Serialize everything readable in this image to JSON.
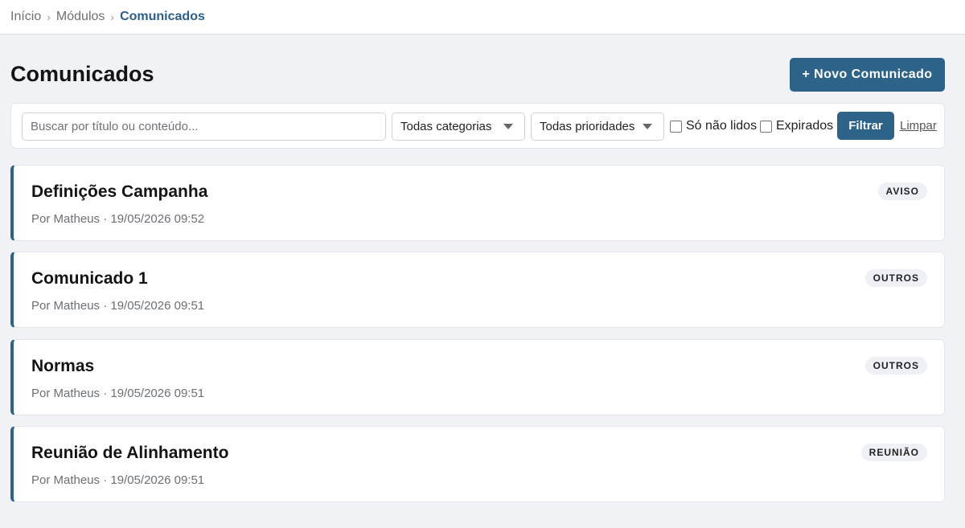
{
  "breadcrumb": {
    "items": [
      "Início",
      "Módulos",
      "Comunicados"
    ],
    "separator": "›"
  },
  "page": {
    "title": "Comunicados",
    "new_button_label": "+ Novo Comunicado"
  },
  "filters": {
    "search_placeholder": "Buscar por título ou conteúdo...",
    "search_value": "",
    "category_selected": "Todas categorias",
    "priority_selected": "Todas prioridades",
    "only_unread_label": "Só não lidos",
    "only_unread_checked": false,
    "expired_label": "Expirados",
    "expired_checked": false,
    "filter_button_label": "Filtrar",
    "clear_link_label": "Limpar"
  },
  "announcements": [
    {
      "title": "Definições Campanha",
      "meta": "Por Matheus · 19/05/2026 09:52",
      "badge": "AVISO"
    },
    {
      "title": "Comunicado 1",
      "meta": "Por Matheus · 19/05/2026 09:51",
      "badge": "OUTROS"
    },
    {
      "title": "Normas",
      "meta": "Por Matheus · 19/05/2026 09:51",
      "badge": "OUTROS"
    },
    {
      "title": "Reunião de Alinhamento",
      "meta": "Por Matheus · 19/05/2026 09:51",
      "badge": "REUNIÃO"
    }
  ],
  "colors": {
    "accent": "#2d6289",
    "background": "#f1f2f6",
    "badge_bg": "#eef0f6"
  }
}
